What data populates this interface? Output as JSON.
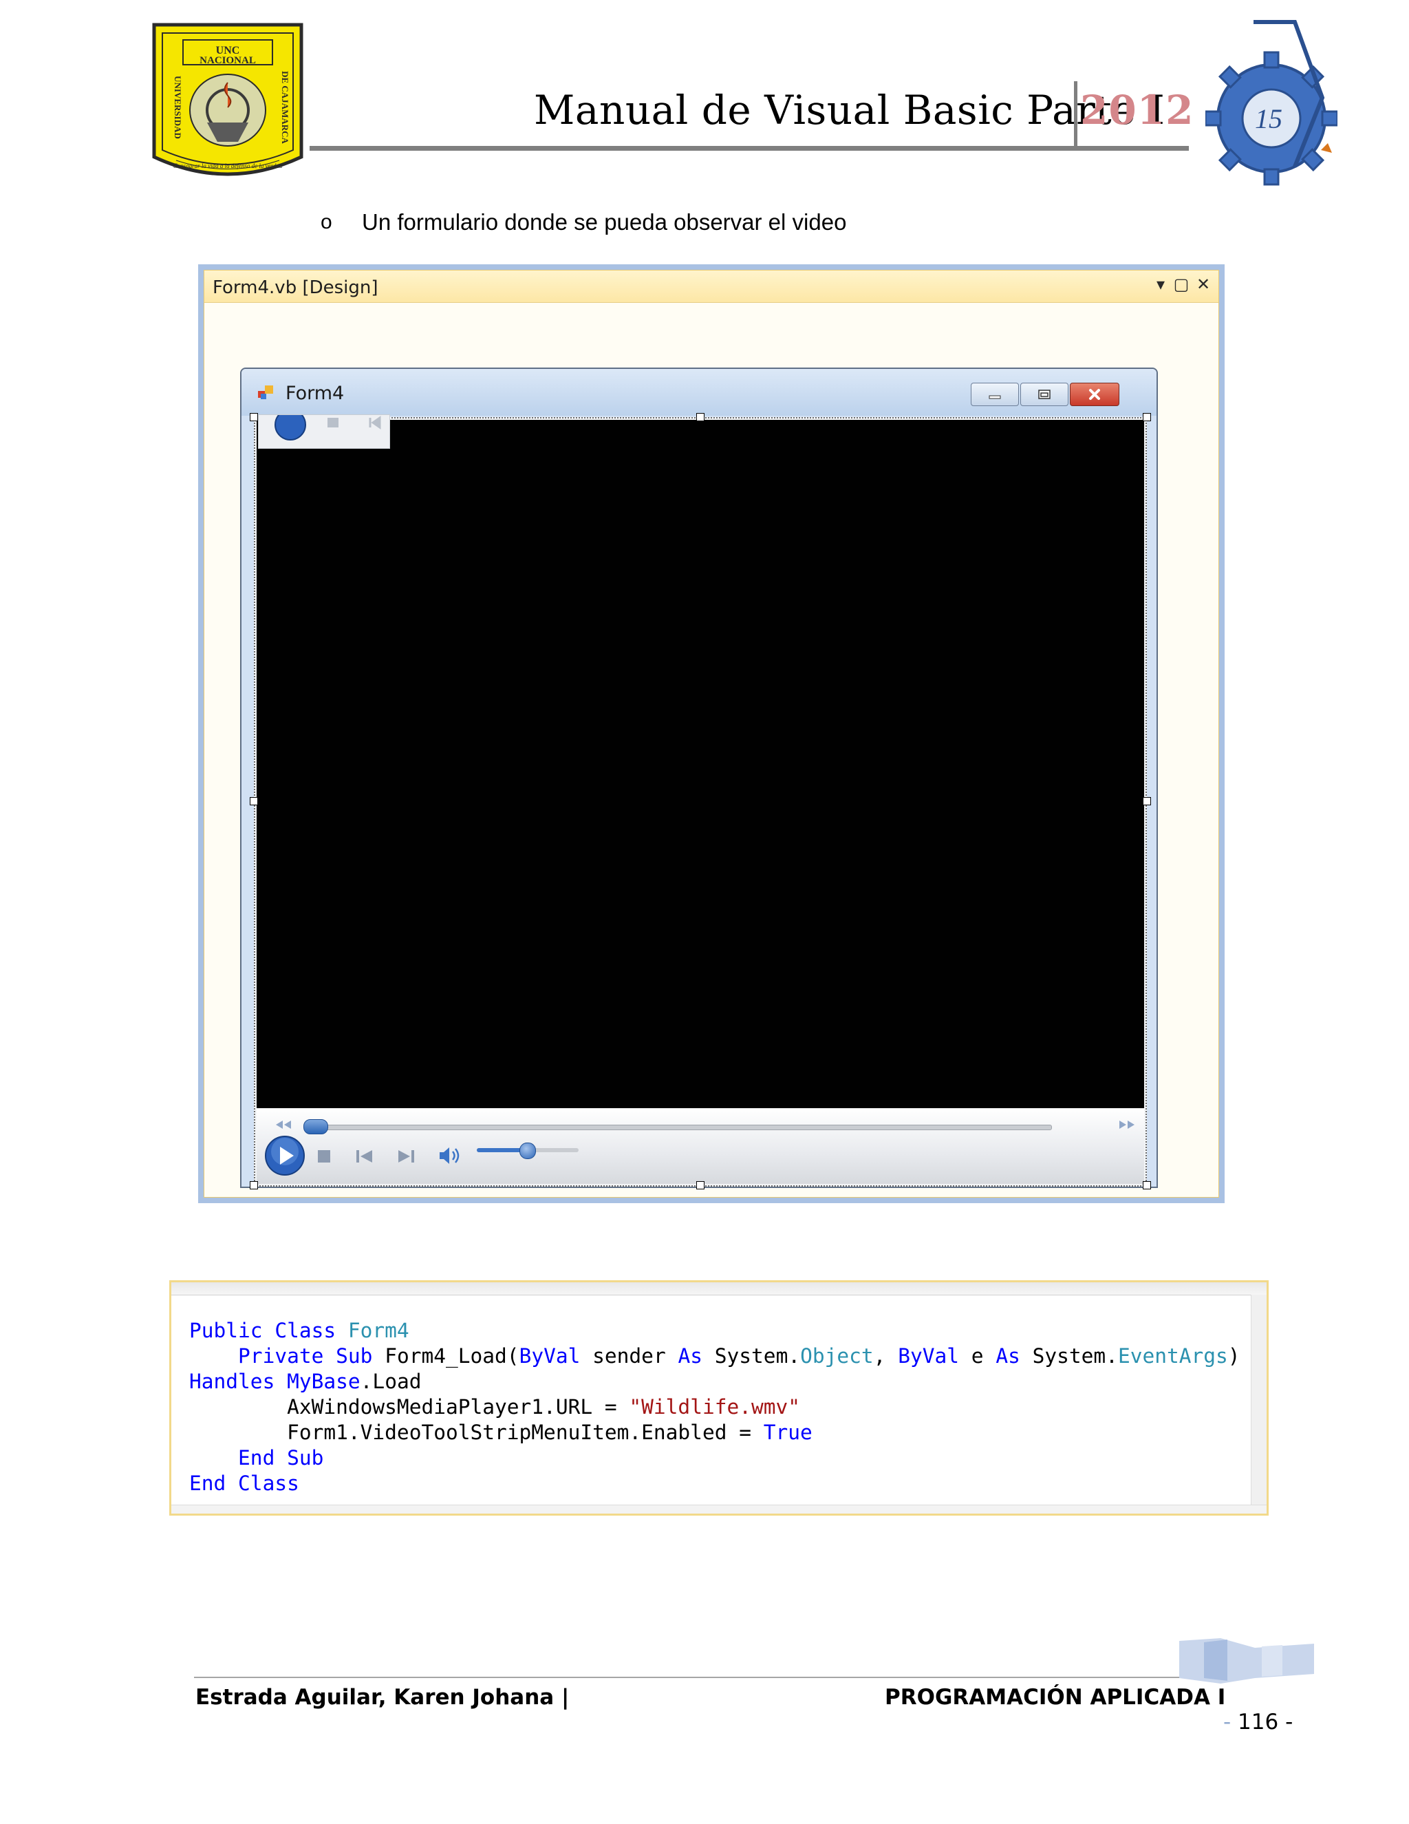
{
  "header": {
    "title": "Manual de Visual Basic Parte I",
    "year": "2012",
    "logo_left_text": {
      "top": "UNC",
      "band": "NACIONAL",
      "left": "UNIVERSIDAD",
      "right": "DE CAJAMARCA",
      "motto": "Consagrar la vida a la defensa de la verdad"
    },
    "logo_right_text": "15"
  },
  "bullet": {
    "mark": "o",
    "text": "Un formulario donde se pueda observar el video"
  },
  "designer": {
    "tab_title": "Form4.vb [Design]",
    "dropdown_glyph": "▾",
    "maximize_glyph": "▢",
    "close_glyph": "✕",
    "form": {
      "title": "Form4"
    },
    "player": {
      "seek_position": 0.0,
      "volume_level": 0.5
    }
  },
  "code_lines": [
    [
      {
        "t": "kw",
        "v": "Public Class "
      },
      {
        "t": "ty",
        "v": "Form4"
      }
    ],
    [
      {
        "t": "",
        "v": "    "
      },
      {
        "t": "kw",
        "v": "Private Sub "
      },
      {
        "t": "",
        "v": "Form4_Load("
      },
      {
        "t": "kw",
        "v": "ByVal "
      },
      {
        "t": "",
        "v": "sender "
      },
      {
        "t": "kw",
        "v": "As "
      },
      {
        "t": "",
        "v": "System."
      },
      {
        "t": "ty",
        "v": "Object"
      },
      {
        "t": "",
        "v": ", "
      },
      {
        "t": "kw",
        "v": "ByVal "
      },
      {
        "t": "",
        "v": "e "
      },
      {
        "t": "kw",
        "v": "As "
      },
      {
        "t": "",
        "v": "System."
      },
      {
        "t": "ty",
        "v": "EventArgs"
      },
      {
        "t": "",
        "v": ")"
      }
    ],
    [
      {
        "t": "kw",
        "v": "Handles "
      },
      {
        "t": "kw",
        "v": "MyBase"
      },
      {
        "t": "",
        "v": ".Load"
      }
    ],
    [
      {
        "t": "",
        "v": "        AxWindowsMediaPlayer1.URL = "
      },
      {
        "t": "st",
        "v": "\"Wildlife.wmv\""
      }
    ],
    [
      {
        "t": "",
        "v": "        Form1.VideoToolStripMenuItem.Enabled = "
      },
      {
        "t": "kw",
        "v": "True"
      }
    ],
    [
      {
        "t": "",
        "v": "    "
      },
      {
        "t": "kw",
        "v": "End Sub"
      }
    ],
    [
      {
        "t": "kw",
        "v": "End Class"
      }
    ]
  ],
  "footer": {
    "author": "Estrada Aguilar, Karen Johana |",
    "course": "PROGRAMACIÓN APLICADA I",
    "page_prefix": "-",
    "page_number": "116",
    "page_suffix": "-"
  },
  "colors": {
    "keyword": "#0000ff",
    "type": "#2b91af",
    "string": "#a31515",
    "year": "#d4868a"
  }
}
